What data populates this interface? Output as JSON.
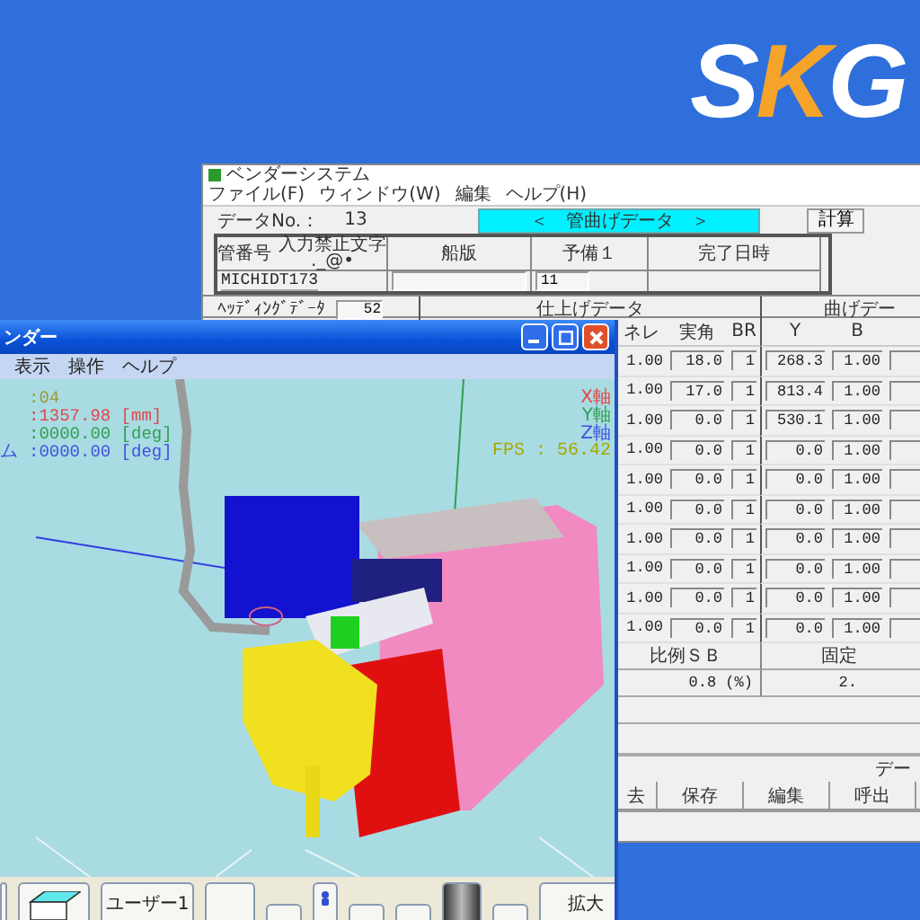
{
  "logo": {
    "text": "SKG"
  },
  "back_window": {
    "title": "ベンダーシステム",
    "menu": [
      "ファイル(F)",
      "ウィンドウ(W)",
      "編集",
      "ヘルプ(H)"
    ],
    "data_no_label": "データNo.：",
    "data_no": "13",
    "banner": "＜　管曲げデータ　＞",
    "calc_button": "計算",
    "header_columns": [
      {
        "label": "管番号",
        "note": [
          "入力禁止文字",
          "._@•"
        ]
      },
      {
        "label": "船版"
      },
      {
        "label": "予備１"
      },
      {
        "label": "完了日時"
      }
    ],
    "header_cells": [
      {
        "kind": "text",
        "value": "MICHIDT173"
      },
      {
        "kind": "field"
      },
      {
        "kind": "field",
        "value": "11"
      },
      {
        "kind": "text"
      }
    ],
    "heading_label": "ﾍｯﾃﾞｨﾝｸﾞﾃﾞｰﾀ",
    "heading_value": "52",
    "groups": [
      "仕上げデータ",
      "曲げデー"
    ],
    "columns": [
      "ネレ",
      "実角",
      "BR",
      "Y",
      "B"
    ],
    "rows": [
      [
        "1.00",
        "18.0",
        "1",
        "268.3",
        "1.00"
      ],
      [
        "1.00",
        "17.0",
        "1",
        "813.4",
        "1.00"
      ],
      [
        "1.00",
        "0.0",
        "1",
        "530.1",
        "1.00"
      ],
      [
        "1.00",
        "0.0",
        "1",
        "0.0",
        "1.00"
      ],
      [
        "1.00",
        "0.0",
        "1",
        "0.0",
        "1.00"
      ],
      [
        "1.00",
        "0.0",
        "1",
        "0.0",
        "1.00"
      ],
      [
        "1.00",
        "0.0",
        "1",
        "0.0",
        "1.00"
      ],
      [
        "1.00",
        "0.0",
        "1",
        "0.0",
        "1.00"
      ],
      [
        "1.00",
        "0.0",
        "1",
        "0.0",
        "1.00"
      ],
      [
        "1.00",
        "0.0",
        "1",
        "0.0",
        "1.00"
      ]
    ],
    "ratio": {
      "label": "比例ＳＢ",
      "value": "0.8 (%)"
    },
    "fixed": {
      "label": "固定",
      "value": "2."
    },
    "data_caption": "デー",
    "buttons": [
      "去",
      "保存",
      "編集",
      "呼出"
    ]
  },
  "sim_window": {
    "title": "ンダー",
    "menu": [
      "表示",
      "操作",
      "ヘルプ"
    ],
    "readouts": [
      {
        "value": ":04",
        "color": "#9a9a30"
      },
      {
        "value": ":1357.98 [mm]",
        "color": "#e04848"
      },
      {
        "value": ":0000.00 [deg]",
        "color": "#30a050"
      },
      {
        "label": "ム",
        "value": ":0000.00 [deg]",
        "color": "#4050e0"
      }
    ],
    "axes": [
      {
        "label": "X軸",
        "color": "#e04848"
      },
      {
        "label": "Y軸",
        "color": "#30a050"
      },
      {
        "label": "Z軸",
        "color": "#4050e0"
      }
    ],
    "fps": "FPS : 56.42",
    "toolbar": [
      {
        "kind": "edge"
      },
      {
        "kind": "cube"
      },
      {
        "kind": "text",
        "label": "ユーザー1"
      },
      {
        "kind": "plain"
      },
      {
        "kind": "small"
      },
      {
        "kind": "person"
      },
      {
        "kind": "small"
      },
      {
        "kind": "small"
      },
      {
        "kind": "dark"
      },
      {
        "kind": "small"
      },
      {
        "kind": "text",
        "label": "拡大"
      }
    ]
  }
}
